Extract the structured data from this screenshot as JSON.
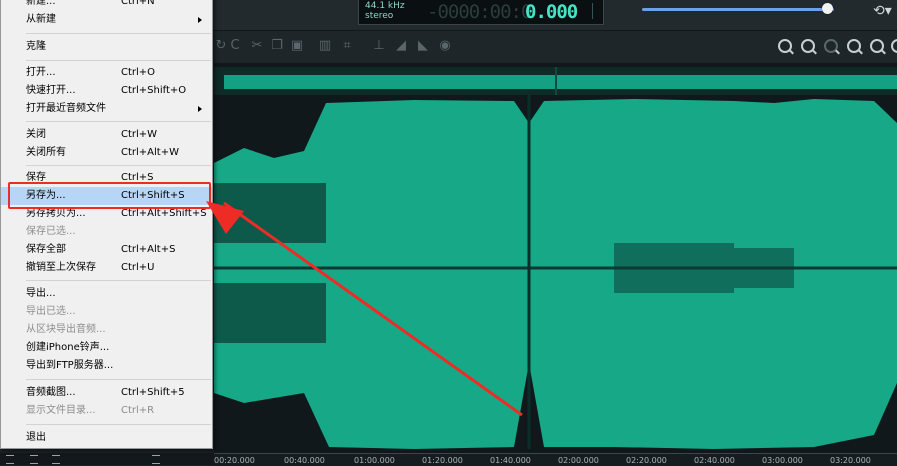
{
  "lcd": {
    "sample_rate": "44.1 kHz",
    "channels": "stereo",
    "ghost_digits": "-0000:00:0",
    "time": "0.000"
  },
  "volume": {
    "level": 0.97
  },
  "timeline": {
    "ticks": [
      "00:20.000",
      "00:40.000",
      "01:00.000",
      "01:20.000",
      "01:40.000",
      "02:00.000",
      "02:20.000",
      "02:40.000",
      "03:00.000",
      "03:20.000"
    ]
  },
  "menu": {
    "items": [
      {
        "label": "新建...",
        "shortcut": "Ctrl+N",
        "disabled": false
      },
      {
        "label": "从新建",
        "shortcut": "",
        "disabled": false,
        "submenu": true
      },
      {
        "label": "克隆",
        "shortcut": "",
        "disabled": false
      },
      {
        "label": "打开...",
        "shortcut": "Ctrl+O",
        "disabled": false
      },
      {
        "label": "快速打开...",
        "shortcut": "Ctrl+Shift+O",
        "disabled": false
      },
      {
        "label": "打开最近音频文件",
        "shortcut": "",
        "disabled": false,
        "submenu": true
      },
      {
        "label": "关闭",
        "shortcut": "Ctrl+W",
        "disabled": false
      },
      {
        "label": "关闭所有",
        "shortcut": "Ctrl+Alt+W",
        "disabled": false
      },
      {
        "label": "保存",
        "shortcut": "Ctrl+S",
        "disabled": false
      },
      {
        "label": "另存为...",
        "shortcut": "Ctrl+Shift+S",
        "disabled": false,
        "selected": true
      },
      {
        "label": "另存拷贝为...",
        "shortcut": "Ctrl+Alt+Shift+S",
        "disabled": false
      },
      {
        "label": "保存已选...",
        "shortcut": "",
        "disabled": true
      },
      {
        "label": "保存全部",
        "shortcut": "Ctrl+Alt+S",
        "disabled": false
      },
      {
        "label": "撤销至上次保存",
        "shortcut": "Ctrl+U",
        "disabled": false
      },
      {
        "label": "导出...",
        "shortcut": "",
        "disabled": false
      },
      {
        "label": "导出已选...",
        "shortcut": "",
        "disabled": true
      },
      {
        "label": "从区块导出音频...",
        "shortcut": "",
        "disabled": true
      },
      {
        "label": "创建iPhone铃声...",
        "shortcut": "",
        "disabled": false
      },
      {
        "label": "导出到FTP服务器...",
        "shortcut": "",
        "disabled": false
      },
      {
        "label": "音频截图...",
        "shortcut": "Ctrl+Shift+5",
        "disabled": false
      },
      {
        "label": "显示文件目录...",
        "shortcut": "Ctrl+R",
        "disabled": true
      },
      {
        "label": "退出",
        "shortcut": "",
        "disabled": false
      }
    ]
  },
  "colors": {
    "waveform": "#16a887",
    "waveform_dark": "#0e5a4c",
    "highlight": "#ee2b25",
    "lcd_text": "#47e3c6"
  }
}
